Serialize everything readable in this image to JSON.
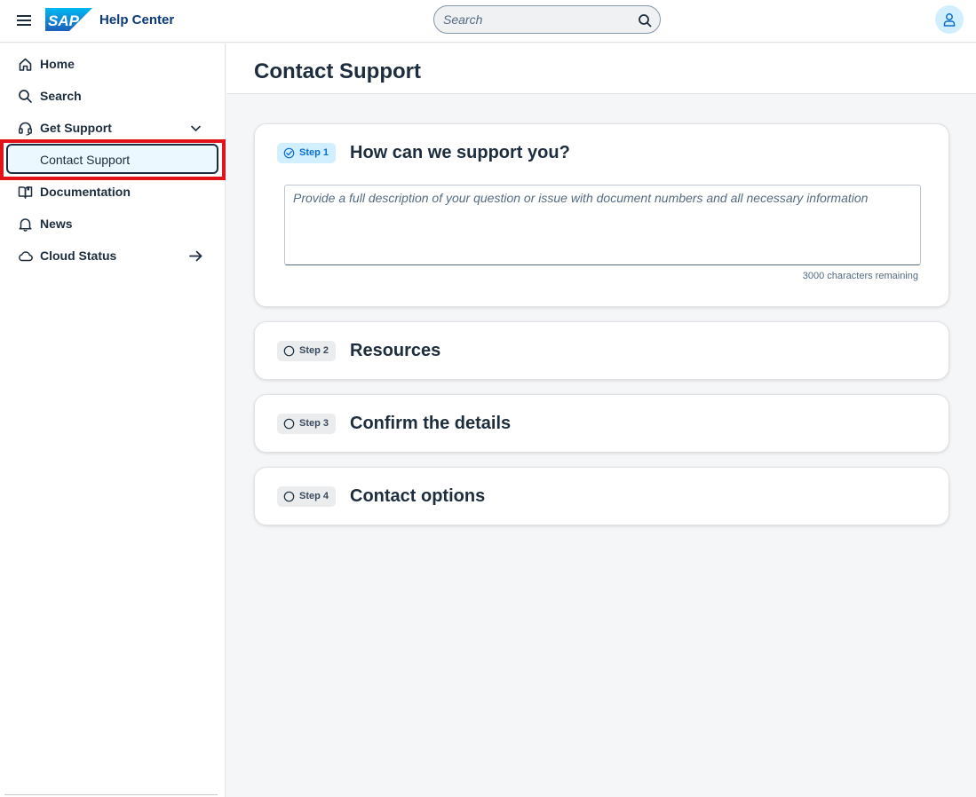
{
  "header": {
    "logo_text": "SAP",
    "app_title": "Help Center",
    "search_placeholder": "Search"
  },
  "sidebar": {
    "items": [
      {
        "label": "Home",
        "icon": "home-icon"
      },
      {
        "label": "Search",
        "icon": "search-icon"
      },
      {
        "label": "Get Support",
        "icon": "headset-icon",
        "trailing": "chevron-down-icon"
      },
      {
        "label": "Contact Support"
      },
      {
        "label": "Documentation",
        "icon": "book-icon"
      },
      {
        "label": "News",
        "icon": "bell-icon"
      },
      {
        "label": "Cloud Status",
        "icon": "cloud-icon",
        "trailing": "arrow-right-icon"
      }
    ]
  },
  "main": {
    "page_title": "Contact Support",
    "steps": [
      {
        "badge": "Step 1",
        "title": "How can we support you?",
        "state": "active"
      },
      {
        "badge": "Step 2",
        "title": "Resources",
        "state": "pending"
      },
      {
        "badge": "Step 3",
        "title": "Confirm the details",
        "state": "pending"
      },
      {
        "badge": "Step 4",
        "title": "Contact options",
        "state": "pending"
      }
    ],
    "description_placeholder": "Provide a full description of your question or issue with document numbers and all necessary information",
    "description_value": "",
    "counter_text": "3000 characters remaining"
  },
  "colors": {
    "brand": "#0a6ed1",
    "highlight": "#e3131b",
    "selected_bg": "#ebf8ff"
  }
}
